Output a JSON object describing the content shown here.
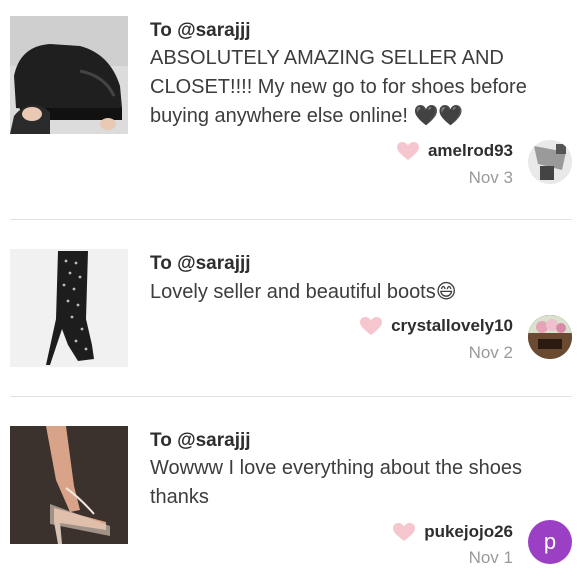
{
  "reviews": [
    {
      "to": "To @sarajjj",
      "text": "ABSOLUTELY AMAZING SELLER AND CLOSET!!!! My new go to for shoes before buying anywhere else online! 🖤🖤",
      "username": "amelrod93",
      "date": "Nov 3",
      "thumbnail": "black-platform-sneaker-image",
      "avatar": "avatar-photo"
    },
    {
      "to": "To @sarajjj",
      "text": "Lovely seller and beautiful boots😄",
      "username": "crystallovely10",
      "date": "Nov 2",
      "thumbnail": "studded-thigh-high-boot-image",
      "avatar": "avatar-photo"
    },
    {
      "to": "To @sarajjj",
      "text": "Wowww I love everything about the shoes thanks",
      "username": "pukejojo26",
      "date": "Nov 1",
      "thumbnail": "clear-strap-heel-image",
      "avatar_letter": "p",
      "avatar_color": "#9b3fc4"
    }
  ],
  "colors": {
    "heart": "#f6c6cf",
    "divider": "#e2e2e2",
    "date": "#9a9a9a"
  }
}
